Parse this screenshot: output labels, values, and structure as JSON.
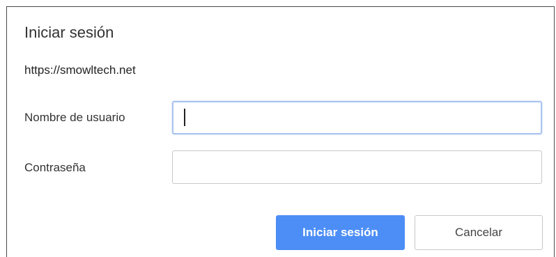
{
  "dialog": {
    "title": "Iniciar sesión",
    "origin": "https://smowltech.net",
    "username": {
      "label": "Nombre de usuario",
      "value": ""
    },
    "password": {
      "label": "Contraseña",
      "value": ""
    },
    "buttons": {
      "submit_label": "Iniciar sesión",
      "cancel_label": "Cancelar"
    },
    "colors": {
      "primary_button": "#4d8ef6",
      "focus_border": "#a9c4ef"
    }
  }
}
